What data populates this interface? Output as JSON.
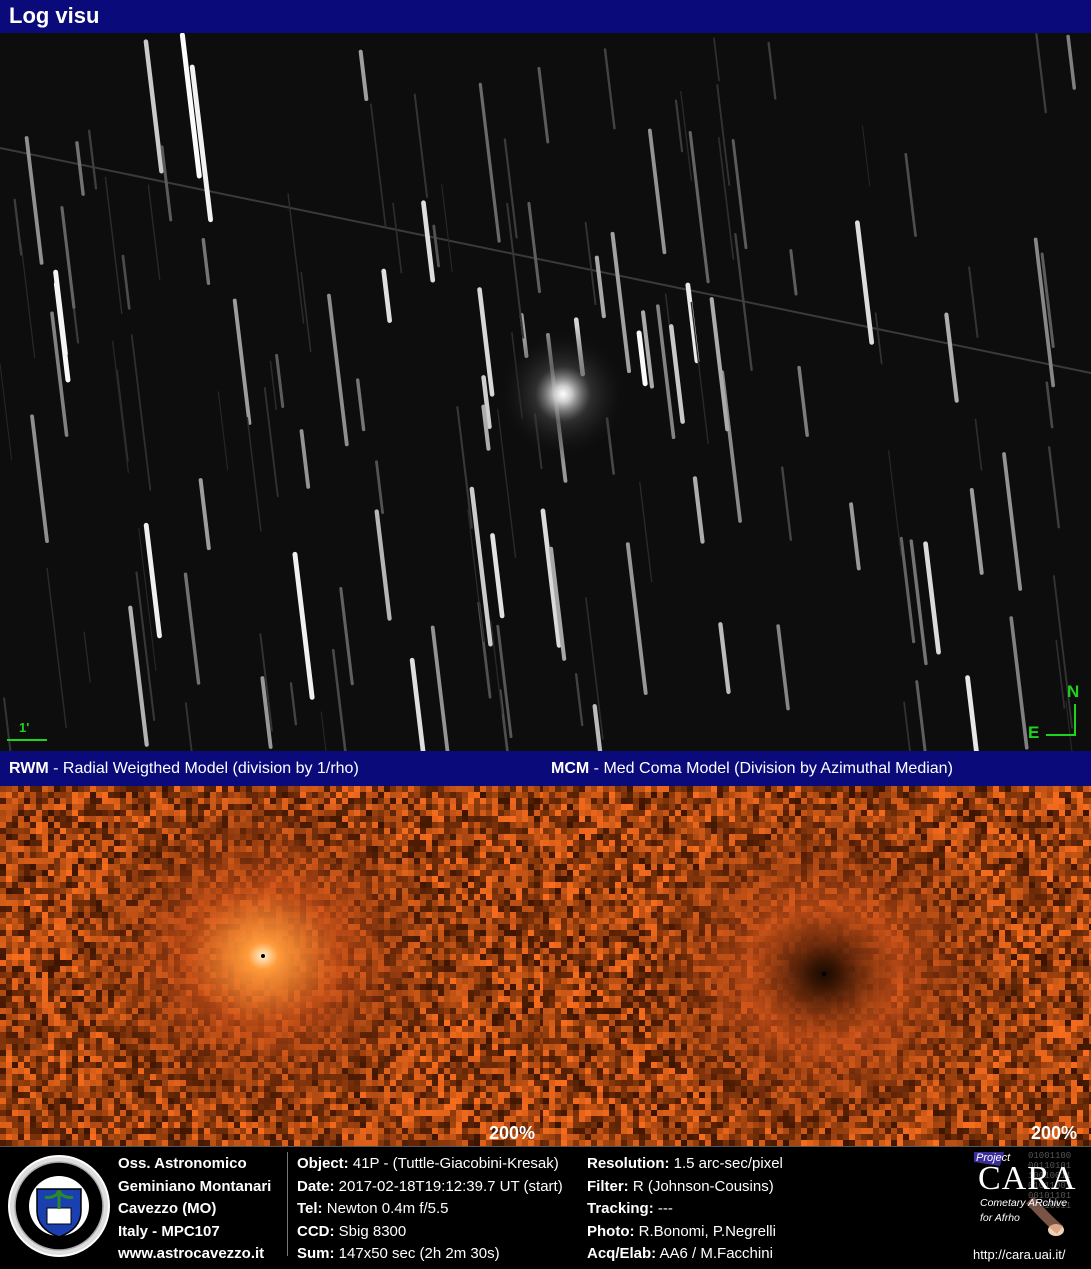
{
  "title": "Log visu",
  "scale_label": "1'",
  "compass": {
    "north": "N",
    "east": "E"
  },
  "models": {
    "left_abbr": "RWM",
    "left_desc": " - Radial Weigthed Model (division by 1/rho)",
    "right_abbr": "MCM",
    "right_desc": " - Med Coma Model (Division by Azimuthal Median)"
  },
  "zoom": {
    "left": "200%",
    "right": "200%"
  },
  "observatory": {
    "line1": "Oss. Astronomico",
    "line2": "Geminiano Montanari",
    "line3": "Cavezzo (MO)",
    "line4": "Italy - MPC107",
    "line5": "www.astrocavezzo.it",
    "seal_text": "OSSERVATORIO ASTRONOMICO G.MONTANARI CAVEZZO"
  },
  "info_left": [
    {
      "key": "Object:",
      "value": " 41P - (Tuttle-Giacobini-Kresak)"
    },
    {
      "key": "Date:",
      "value": " 2017-02-18T19:12:39.7 UT (start)"
    },
    {
      "key": "Tel:",
      "value": " Newton 0.4m f/5.5"
    },
    {
      "key": "CCD:",
      "value": " Sbig 8300"
    },
    {
      "key": "Sum:",
      "value": " 147x50 sec (2h 2m 30s)"
    }
  ],
  "info_right": [
    {
      "key": "Resolution:",
      "value": " 1.5 arc-sec/pixel"
    },
    {
      "key": "Filter:",
      "value": " R (Johnson-Cousins)"
    },
    {
      "key": "Tracking:",
      "value": " ---"
    },
    {
      "key": "Photo:",
      "value": " R.Bonomi, P.Negrelli"
    },
    {
      "key": "Acq/Elab:",
      "value": " AA6 / M.Facchini"
    }
  ],
  "cara": {
    "project": "Project",
    "name": "CARA",
    "sub1": "Cometary ARchive",
    "sub2": "for Afrho",
    "url": "http://cara.uai.it/",
    "binary": "01001100\n00110101\n10010011\n01011001\n00101101\n10010011"
  },
  "colors": {
    "header": "#0a0a7a",
    "overlay": "#1ed31e",
    "coma": "#ff7a2a"
  }
}
